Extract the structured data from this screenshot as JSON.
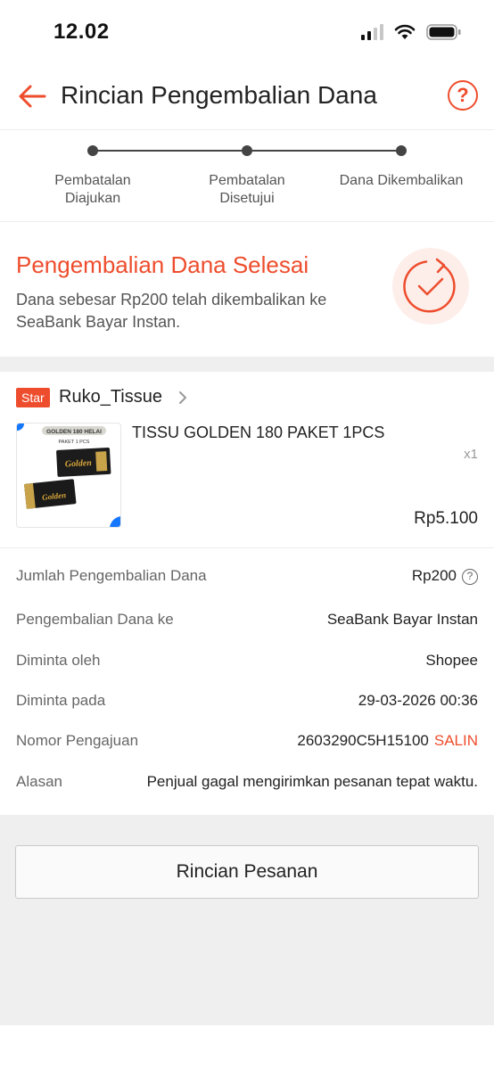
{
  "status_bar": {
    "time": "12.02"
  },
  "header": {
    "title": "Rincian Pengembalian Dana",
    "help_icon": "?"
  },
  "progress": {
    "steps": [
      {
        "label_line1": "Pembatalan",
        "label_line2": "Diajukan"
      },
      {
        "label_line1": "Pembatalan",
        "label_line2": "Disetujui"
      },
      {
        "label_line1": "Dana Dikembalikan",
        "label_line2": ""
      }
    ]
  },
  "result": {
    "title": "Pengembalian Dana Selesai",
    "description": "Dana sebesar Rp200 telah dikembalikan ke SeaBank Bayar Instan."
  },
  "shop": {
    "badge": "Star",
    "name": "Ruko_Tissue",
    "product": {
      "name": "TISSU GOLDEN 180 PAKET 1PCS",
      "quantity": "x1",
      "price": "Rp5.100",
      "image_text_top": "GOLDEN 180 HELAI",
      "image_text_sub": "PAKET 1 PCS",
      "image_brand": "Golden"
    }
  },
  "details": {
    "refund_amount": {
      "label": "Jumlah Pengembalian Dana",
      "value": "Rp200"
    },
    "refund_to": {
      "label": "Pengembalian Dana ke",
      "value": "SeaBank Bayar Instan"
    },
    "requested_by": {
      "label": "Diminta oleh",
      "value": "Shopee"
    },
    "requested_at": {
      "label": "Diminta pada",
      "value": "29-03-2026 00:36"
    },
    "request_number": {
      "label": "Nomor Pengajuan",
      "value": "2603290C5H15100",
      "copy_label": "SALIN"
    },
    "reason": {
      "label": "Alasan",
      "value": "Penjual gagal mengirimkan pesanan tepat waktu."
    }
  },
  "order_button": {
    "label": "Rincian Pesanan"
  },
  "colors": {
    "accent": "#ee4d2d",
    "background_gray": "#efefef"
  }
}
